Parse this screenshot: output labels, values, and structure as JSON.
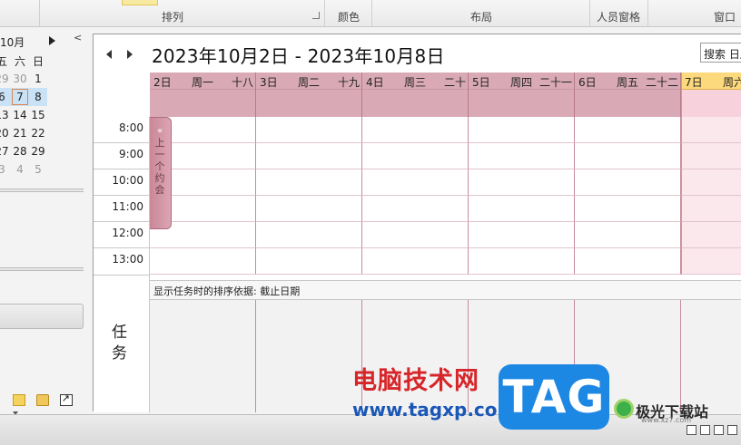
{
  "ribbon": {
    "groups": [
      "排列",
      "颜色",
      "布局",
      "人员窗格",
      "窗口"
    ]
  },
  "navigation": {
    "month_label": "10月",
    "weekday_headers": [
      "五",
      "六",
      "日"
    ],
    "weeks": [
      [
        "29",
        "30",
        "1"
      ],
      [
        "6",
        "7",
        "8"
      ],
      [
        "13",
        "14",
        "15"
      ],
      [
        "20",
        "21",
        "22"
      ],
      [
        "27",
        "28",
        "29"
      ],
      [
        "3",
        "4",
        "5"
      ]
    ]
  },
  "calendar": {
    "title": "2023年10月2日 - 2023年10月8日",
    "search_placeholder": "搜索 日历",
    "days": [
      {
        "date": "2日",
        "weekday": "周一",
        "lunar": "十八"
      },
      {
        "date": "3日",
        "weekday": "周二",
        "lunar": "十九"
      },
      {
        "date": "4日",
        "weekday": "周三",
        "lunar": "二十"
      },
      {
        "date": "5日",
        "weekday": "周四",
        "lunar": "二十一"
      },
      {
        "date": "6日",
        "weekday": "周五",
        "lunar": "二十二"
      },
      {
        "date": "7日",
        "weekday": "周六",
        "lunar": ""
      }
    ],
    "times": [
      "8:00",
      "9:00",
      "10:00",
      "11:00",
      "12:00",
      "13:00"
    ],
    "prev_appointment": "上一个约会",
    "task_sort_label": "显示任务时的排序依据: 截止日期",
    "tasks_label": "任务"
  },
  "colors": {
    "header_bg": "#d9aab6",
    "today_highlight": "#fcd97d",
    "today_bg": "#fbe8ed"
  },
  "watermark": {
    "site_cn": "电脑技术网",
    "site_url": "www.tagxp.com",
    "tag": "TAG",
    "xz_name": "极光下载站",
    "xz_url": "www.xz7.com"
  }
}
